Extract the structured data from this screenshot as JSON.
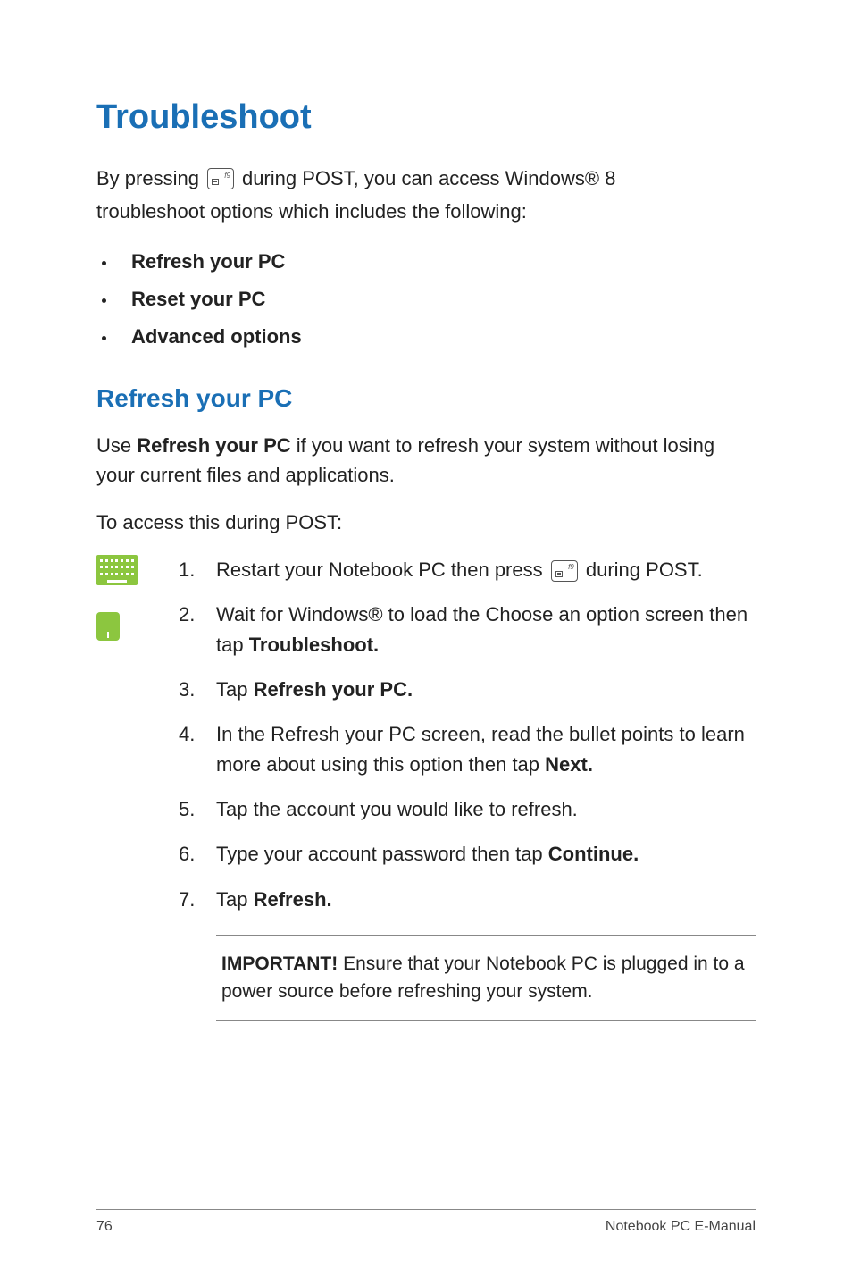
{
  "title": "Troubleshoot",
  "intro": {
    "before_key": "By pressing",
    "after_key": "during POST, you can access Windows® 8",
    "line2": "troubleshoot options which includes the following:"
  },
  "bullets": [
    "Refresh your PC",
    "Reset your PC",
    "Advanced options"
  ],
  "section": {
    "heading": "Refresh your PC",
    "para_prefix": "Use ",
    "para_bold": "Refresh your PC",
    "para_suffix": " if you want to refresh your system without losing your current files and applications.",
    "access_line": "To access this during POST:"
  },
  "steps": {
    "s1": {
      "num": "1.",
      "before": "Restart your Notebook PC then press",
      "after": "during POST."
    },
    "s2": {
      "num": "2.",
      "text_before": "Wait for Windows® to load the Choose an option screen then tap ",
      "bold": "Troubleshoot."
    },
    "s3": {
      "num": "3.",
      "text_before": "Tap ",
      "bold": "Refresh your PC."
    },
    "s4": {
      "num": "4.",
      "text_before": "In the Refresh your PC screen, read the bullet points to learn more about using this option then tap ",
      "bold": "Next."
    },
    "s5": {
      "num": "5.",
      "text": "Tap the account you would like to refresh."
    },
    "s6": {
      "num": "6.",
      "text_before": "Type your account password then tap ",
      "bold": "Continue."
    },
    "s7": {
      "num": "7.",
      "text_before": "Tap ",
      "bold": "Refresh."
    }
  },
  "important": {
    "label": "IMPORTANT!",
    "text": " Ensure that your Notebook PC is plugged in to a power source before refreshing your system."
  },
  "footer": {
    "page": "76",
    "book": "Notebook PC E-Manual"
  },
  "key_label": "f9"
}
